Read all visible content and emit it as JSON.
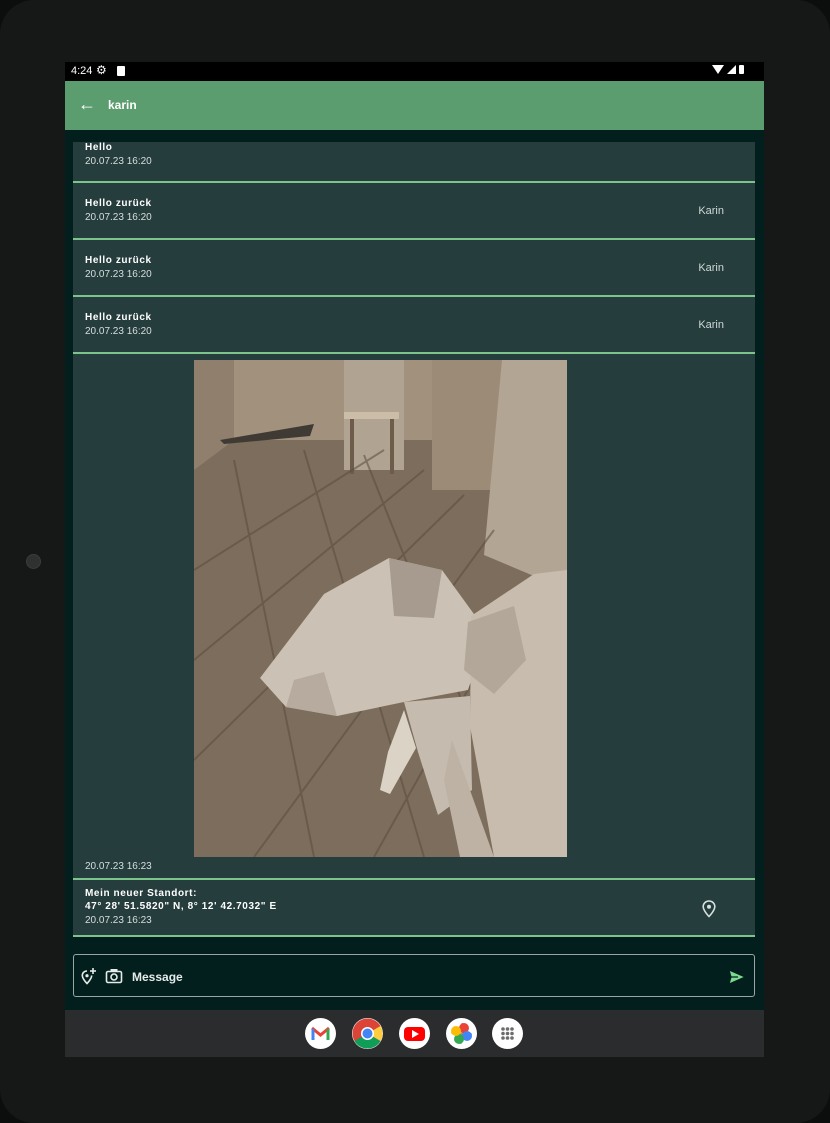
{
  "status_bar": {
    "time": "4:24"
  },
  "app_bar": {
    "title": "karin"
  },
  "messages": [
    {
      "text": "Hello",
      "date": "20.07.23 16:20",
      "author": ""
    },
    {
      "text": "Hello zurück",
      "date": "20.07.23 16:20",
      "author": "Karin"
    },
    {
      "text": "Hello zurück",
      "date": "20.07.23 16:20",
      "author": "Karin"
    },
    {
      "text": "Hello zurück",
      "date": "20.07.23 16:20",
      "author": "Karin"
    }
  ],
  "image_message": {
    "date": "20.07.23 16:23"
  },
  "location_message": {
    "line1": "Mein neuer Standort:",
    "line2": "47° 28' 51.5820\" N, 8° 12' 42.7032\" E",
    "date": "20.07.23 16:23"
  },
  "composer": {
    "placeholder": "Message"
  },
  "colors": {
    "accent": "#5b9d6f",
    "bubble": "#263d3e",
    "divider": "#7cc48c",
    "background": "#021f1e"
  },
  "icons": [
    "back-arrow-icon",
    "add-location-icon",
    "camera-icon",
    "send-icon",
    "location-pin-icon",
    "gmail-icon",
    "chrome-icon",
    "youtube-icon",
    "photos-icon",
    "app-drawer-icon"
  ]
}
